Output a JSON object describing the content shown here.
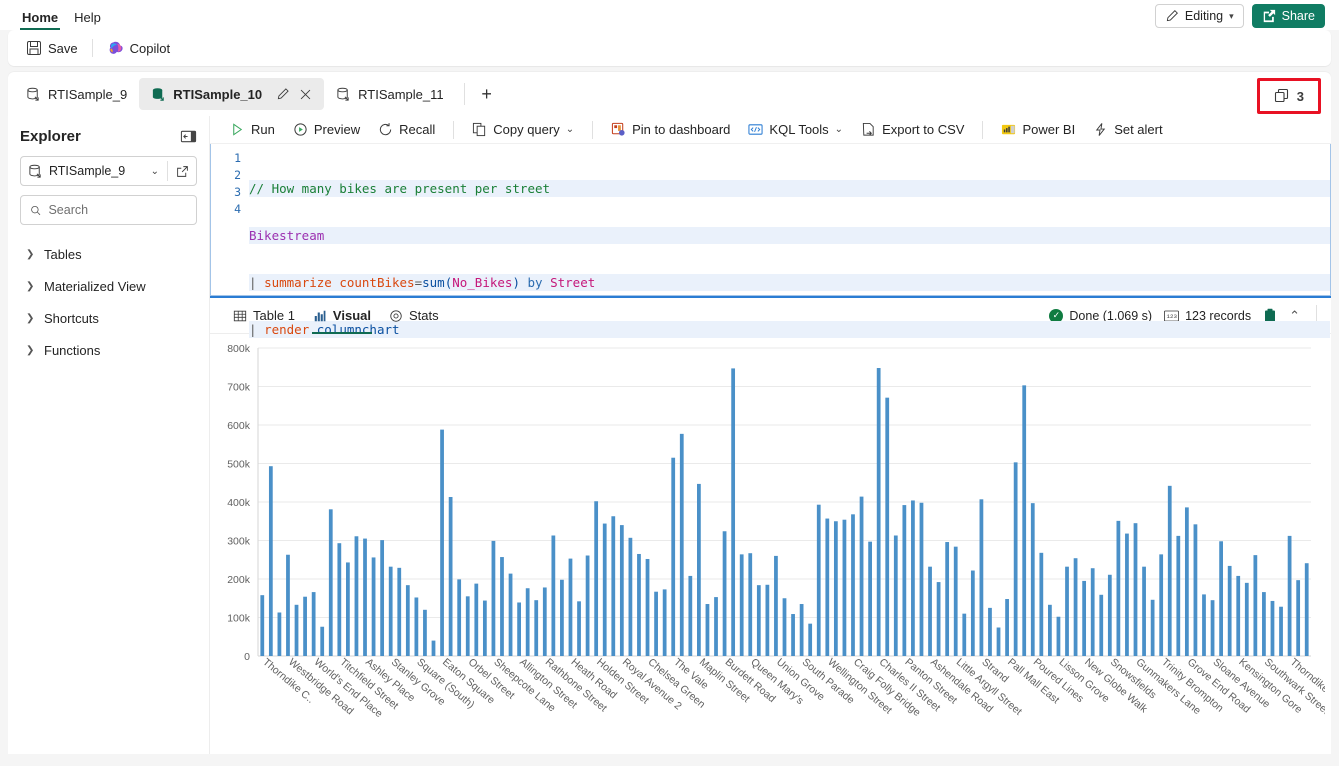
{
  "ribbon": {
    "nav": [
      {
        "label": "Home",
        "active": true
      },
      {
        "label": "Help",
        "active": false
      }
    ],
    "editing_label": "Editing",
    "share_label": "Share"
  },
  "commandbar": {
    "save_label": "Save",
    "copilot_label": "Copilot"
  },
  "tabs": {
    "items": [
      {
        "label": "RTISample_9",
        "active": false
      },
      {
        "label": "RTISample_10",
        "active": true
      },
      {
        "label": "RTISample_11",
        "active": false
      }
    ],
    "add_label": "+",
    "count_badge": "3"
  },
  "explorer": {
    "title": "Explorer",
    "database": "RTISample_9",
    "search_placeholder": "Search",
    "search_value": "",
    "tree": [
      {
        "label": "Tables"
      },
      {
        "label": "Materialized View"
      },
      {
        "label": "Shortcuts"
      },
      {
        "label": "Functions"
      }
    ]
  },
  "query_toolbar": {
    "items": [
      {
        "label": "Run",
        "icon": "play-icon",
        "caret": false
      },
      {
        "label": "Preview",
        "icon": "preview-icon",
        "caret": false
      },
      {
        "label": "Recall",
        "icon": "recall-icon",
        "caret": false
      },
      {
        "label": "Copy query",
        "icon": "copy-icon",
        "caret": true
      },
      {
        "label": "Pin to dashboard",
        "icon": "pin-icon",
        "caret": false
      },
      {
        "label": "KQL Tools",
        "icon": "kql-icon",
        "caret": true
      },
      {
        "label": "Export to CSV",
        "icon": "export-icon",
        "caret": false
      },
      {
        "label": "Power BI",
        "icon": "powerbi-icon",
        "caret": false
      },
      {
        "label": "Set alert",
        "icon": "alert-icon",
        "caret": false
      }
    ]
  },
  "editor": {
    "line_numbers": [
      "1",
      "2",
      "3",
      "4"
    ],
    "lines": [
      "// How many bikes are present per street",
      "Bikestream",
      "| summarize countBikes=sum(No_Bikes) by Street",
      "| render columnchart"
    ]
  },
  "results": {
    "tabs": [
      {
        "label": "Table 1",
        "icon": "table-icon",
        "active": false
      },
      {
        "label": "Visual",
        "icon": "chart-icon",
        "active": true
      },
      {
        "label": "Stats",
        "icon": "stats-icon",
        "active": false
      }
    ],
    "status_text": "Done (1.069 s)",
    "records_text": "123 records"
  },
  "chart_data": {
    "type": "bar",
    "title": "",
    "xlabel": "",
    "ylabel": "",
    "ylim": [
      0,
      800000
    ],
    "ytick_labels": [
      "800k",
      "700k",
      "600k",
      "500k",
      "400k",
      "300k",
      "200k",
      "100k",
      "0"
    ],
    "ytick_values": [
      800000,
      700000,
      600000,
      500000,
      400000,
      300000,
      200000,
      100000,
      0
    ],
    "grid": true,
    "legend": "none",
    "bar_color": "#4a90c8",
    "series_name": "countBikes",
    "categories": [
      "Thorndike C..",
      "Westbridge Road",
      "World's End Place",
      "Titchfield Street",
      "Ashley Place",
      "Stanley Grove",
      "Square (South)",
      "Eaton Square",
      "Orbel Street",
      "Sheepcote Lane",
      "Allington Street",
      "Rathbone Street",
      "Heath Road",
      "Holden Street",
      "Royal Avenue 2",
      "Chelsea Green",
      "The Vale",
      "Maplin Street",
      "Burdett Road",
      "Queen Mary's",
      "Union Grove",
      "South Parade",
      "Wellington Street",
      "Craig Folly Bridge",
      "Charles II Street",
      "Panton Street",
      "Ashendale Road",
      "Little Argyll Street",
      "Strand",
      "Pall Mall East",
      "Poured Lines",
      "Lisson Grove",
      "New Globe Walk",
      "Snowsfields",
      "Gunmakers Lane",
      "Trinity Brompton",
      "Grove End Road",
      "Sloane Avenue",
      "Kensington Gore",
      "Southwark Street",
      "Thorndike Close"
    ],
    "tick_label_indices": [
      0,
      3,
      6,
      9,
      12,
      15,
      18,
      21,
      24,
      27,
      30,
      33,
      36,
      39,
      42,
      45,
      48,
      51,
      54,
      57,
      60,
      63,
      66,
      69,
      72,
      75,
      78,
      81,
      84,
      87,
      90,
      93,
      96,
      99,
      102,
      105,
      108,
      111,
      114,
      117,
      120
    ],
    "values": [
      158000,
      493000,
      113000,
      263000,
      133000,
      154000,
      166000,
      76000,
      381000,
      293000,
      243000,
      311000,
      305000,
      256000,
      301000,
      232000,
      229000,
      184000,
      152000,
      120000,
      40000,
      588000,
      413000,
      199000,
      155000,
      188000,
      144000,
      299000,
      257000,
      214000,
      139000,
      176000,
      145000,
      178000,
      313000,
      198000,
      253000,
      142000,
      261000,
      402000,
      344000,
      363000,
      340000,
      307000,
      265000,
      252000,
      167000,
      173000,
      515000,
      577000,
      208000,
      447000,
      135000,
      153000,
      324000,
      747000,
      264000,
      267000,
      184000,
      185000,
      260000,
      150000,
      109000,
      135000,
      84000,
      393000,
      357000,
      350000,
      354000,
      368000,
      414000,
      297000,
      748000,
      671000,
      313000,
      392000,
      404000,
      398000,
      232000,
      192000,
      296000,
      284000,
      110000,
      222000,
      407000,
      125000,
      74000,
      148000,
      503000,
      703000,
      397000,
      268000,
      133000,
      102000,
      232000,
      254000,
      195000,
      228000,
      159000,
      211000,
      351000,
      318000,
      345000,
      232000,
      146000,
      264000,
      442000,
      312000,
      386000,
      342000,
      160000,
      145000,
      298000,
      234000,
      208000,
      190000,
      262000,
      166000,
      143000,
      128000,
      312000,
      197000,
      241000
    ]
  }
}
